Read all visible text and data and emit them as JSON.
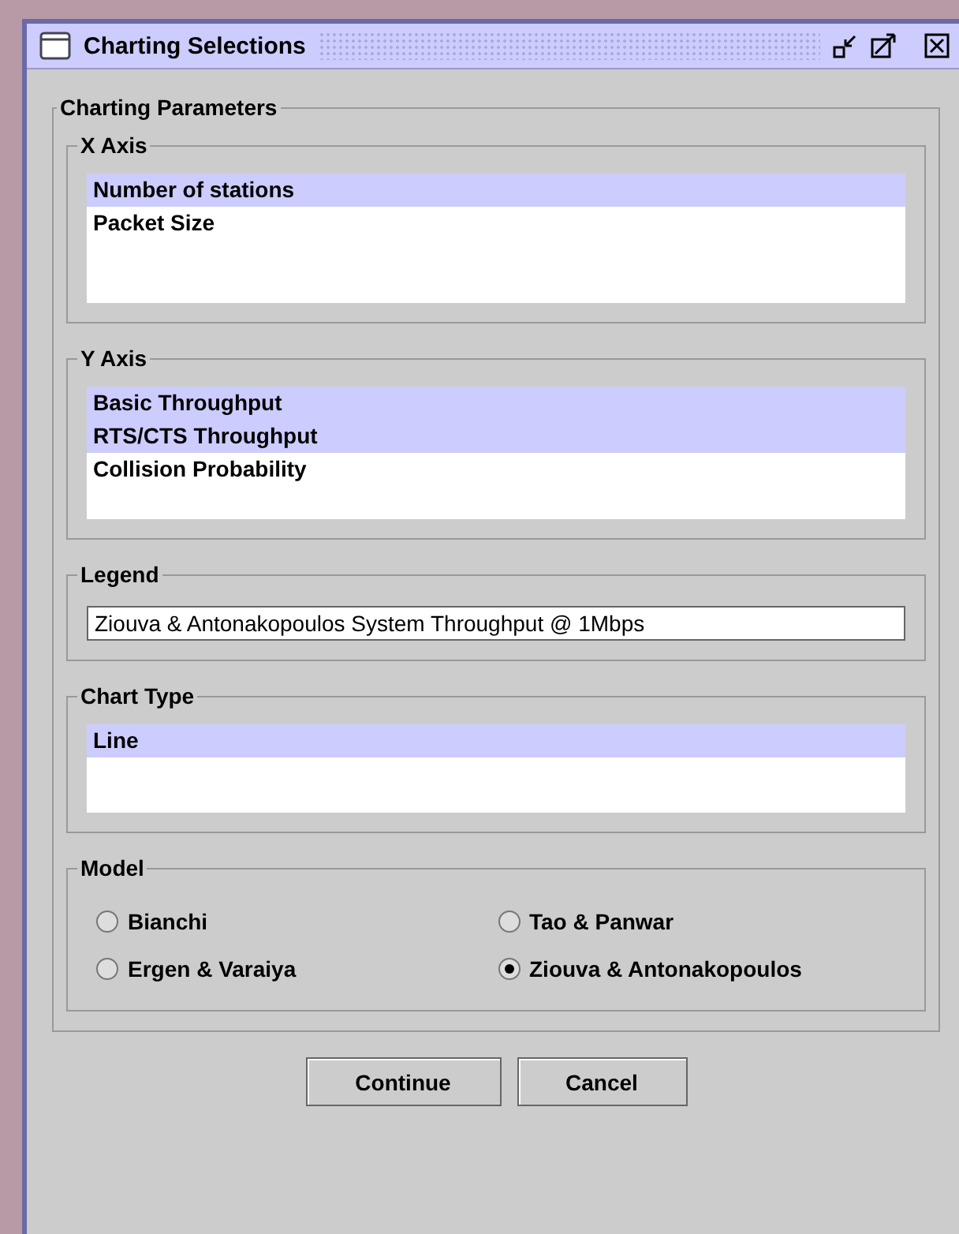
{
  "window": {
    "title": "Charting Selections"
  },
  "parameters": {
    "title": "Charting Parameters"
  },
  "x_axis": {
    "title": "X Axis",
    "items": [
      {
        "label": "Number of stations",
        "selected": true
      },
      {
        "label": "Packet Size",
        "selected": false
      }
    ]
  },
  "y_axis": {
    "title": "Y Axis",
    "items": [
      {
        "label": "Basic Throughput",
        "selected": true
      },
      {
        "label": "RTS/CTS Throughput",
        "selected": true
      },
      {
        "label": "Collision Probability",
        "selected": false
      }
    ]
  },
  "legend": {
    "title": "Legend",
    "value": "Ziouva & Antonakopoulos System Throughput @ 1Mbps"
  },
  "chart_type": {
    "title": "Chart Type",
    "items": [
      {
        "label": "Line",
        "selected": true
      }
    ]
  },
  "model": {
    "title": "Model",
    "options": [
      {
        "label": "Bianchi",
        "selected": false
      },
      {
        "label": "Tao & Panwar",
        "selected": false
      },
      {
        "label": "Ergen & Varaiya",
        "selected": false
      },
      {
        "label": "Ziouva & Antonakopoulos",
        "selected": true
      }
    ]
  },
  "buttons": [
    "Continue",
    "Cancel"
  ]
}
